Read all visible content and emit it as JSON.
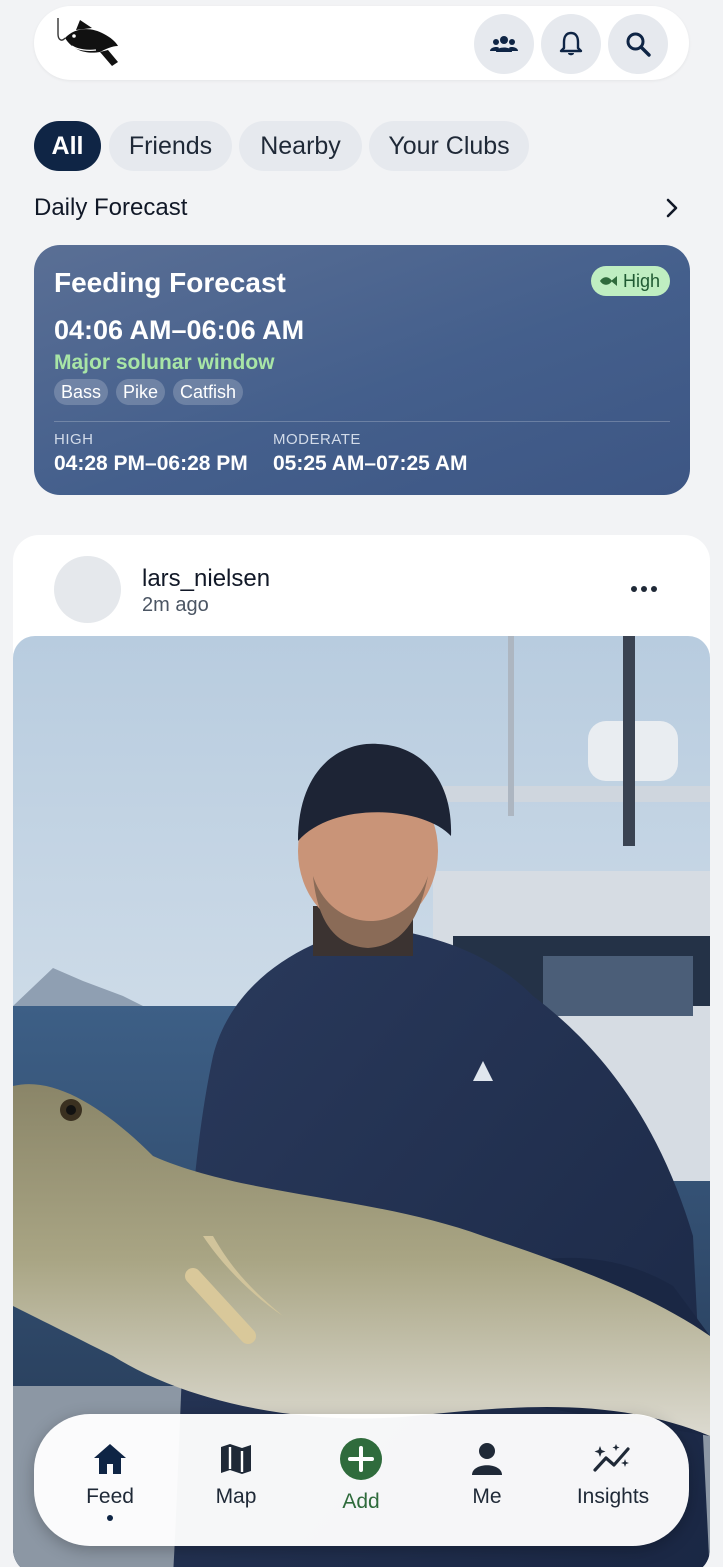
{
  "topbar": {
    "logo_icon": "fish-on-hook-logo",
    "actions": [
      {
        "icon": "people-icon"
      },
      {
        "icon": "bell-icon"
      },
      {
        "icon": "search-icon"
      }
    ]
  },
  "filters": [
    {
      "label": "All",
      "active": true
    },
    {
      "label": "Friends",
      "active": false
    },
    {
      "label": "Nearby",
      "active": false
    },
    {
      "label": "Your Clubs",
      "active": false
    }
  ],
  "forecast_section": {
    "title": "Daily Forecast",
    "arrow_icon": "chevron-right-icon"
  },
  "forecast": {
    "title": "Feeding Forecast",
    "badge": "High",
    "badge_icon": "fish-icon",
    "time": "04:06 AM–06:06 AM",
    "window_label": "Major solunar window",
    "species": [
      "Bass",
      "Pike",
      "Catfish"
    ],
    "high": {
      "label": "HIGH",
      "value": "04:28 PM–06:28 PM"
    },
    "moderate": {
      "label": "MODERATE",
      "value": "05:25 AM–07:25 AM"
    }
  },
  "post": {
    "username": "lars_nielsen",
    "time_ago": "2m ago",
    "more_icon": "more-horizontal-icon"
  },
  "nav": {
    "items": [
      {
        "label": "Feed",
        "icon": "home-icon",
        "active": true
      },
      {
        "label": "Map",
        "icon": "map-icon",
        "active": false
      },
      {
        "label": "Add",
        "icon": "plus-circle-icon",
        "active": false
      },
      {
        "label": "Me",
        "icon": "person-icon",
        "active": false
      },
      {
        "label": "Insights",
        "icon": "insights-icon",
        "active": false
      }
    ]
  },
  "colors": {
    "brand_navy": "#0f2545",
    "card_blue": "#445f8c",
    "accent_green": "#2f6b3c",
    "window_green": "#a8e5a6",
    "badge_green": "#bfeec1"
  }
}
